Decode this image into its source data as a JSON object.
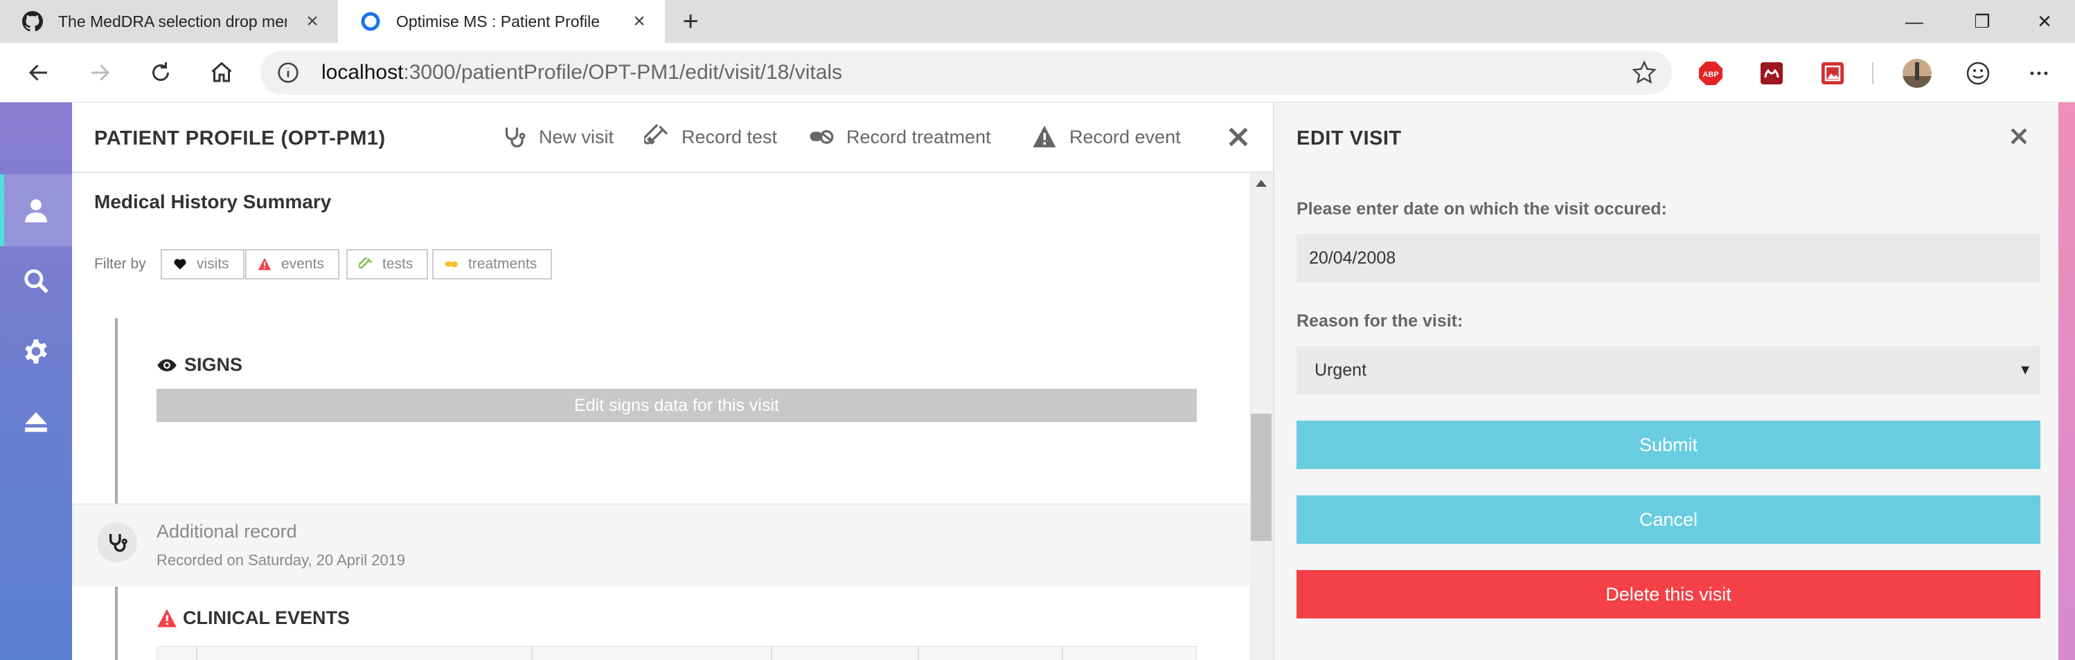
{
  "browser": {
    "tabs": [
      {
        "title": "The MedDRA selection drop men",
        "icon": "github-icon"
      },
      {
        "title": "Optimise MS : Patient Profile",
        "icon": "loading-circle-icon",
        "active": true
      }
    ],
    "address": {
      "url_host": "localhost",
      "url_rest": ":3000/patientProfile/OPT-PM1/edit/visit/18/vitals"
    },
    "extensions": [
      "adblock-icon",
      "mendeley-icon",
      "photo-ext-icon",
      "profile-avatar",
      "emoji-icon",
      "more-icon"
    ],
    "window_controls": {
      "minimize": "—",
      "restore": "❐",
      "close": "✕"
    }
  },
  "sidebar": {
    "items": [
      "profile-icon",
      "search-icon",
      "gear-icon",
      "eject-icon"
    ]
  },
  "profile": {
    "title": "PATIENT PROFILE (OPT-PM1)",
    "actions": [
      {
        "label": "New visit",
        "icon": "stethoscope-icon"
      },
      {
        "label": "Record test",
        "icon": "test-tube-icon"
      },
      {
        "label": "Record treatment",
        "icon": "pills-icon"
      },
      {
        "label": "Record event",
        "icon": "warning-icon"
      }
    ],
    "summary_title": "Medical History Summary",
    "filter_label": "Filter by",
    "filters": [
      {
        "label": "visits",
        "icon": "heart-icon",
        "color": "#111111"
      },
      {
        "label": "events",
        "icon": "warning-icon",
        "color": "#f44046"
      },
      {
        "label": "tests",
        "icon": "test-tube-icon",
        "color": "#7cc04a"
      },
      {
        "label": "treatments",
        "icon": "pills-icon",
        "color": "#f2c22a"
      }
    ],
    "signs_heading": "SIGNS",
    "edit_signs_label": "Edit signs data for this visit",
    "record_title": "Additional record",
    "record_date": "Recorded on Saturday, 20 April 2019",
    "events_heading": "CLINICAL EVENTS"
  },
  "edit_visit": {
    "title": "EDIT VISIT",
    "date_label": "Please enter date on which the visit occured:",
    "date_value": "20/04/2008",
    "reason_label": "Reason for the visit:",
    "reason_value": "Urgent",
    "submit_label": "Submit",
    "cancel_label": "Cancel",
    "delete_label": "Delete this visit"
  },
  "colors": {
    "accent": "#68cde0",
    "danger": "#f44046",
    "sidebar_top": "#8b7bd1",
    "sidebar_bottom": "#5b7fd0"
  }
}
